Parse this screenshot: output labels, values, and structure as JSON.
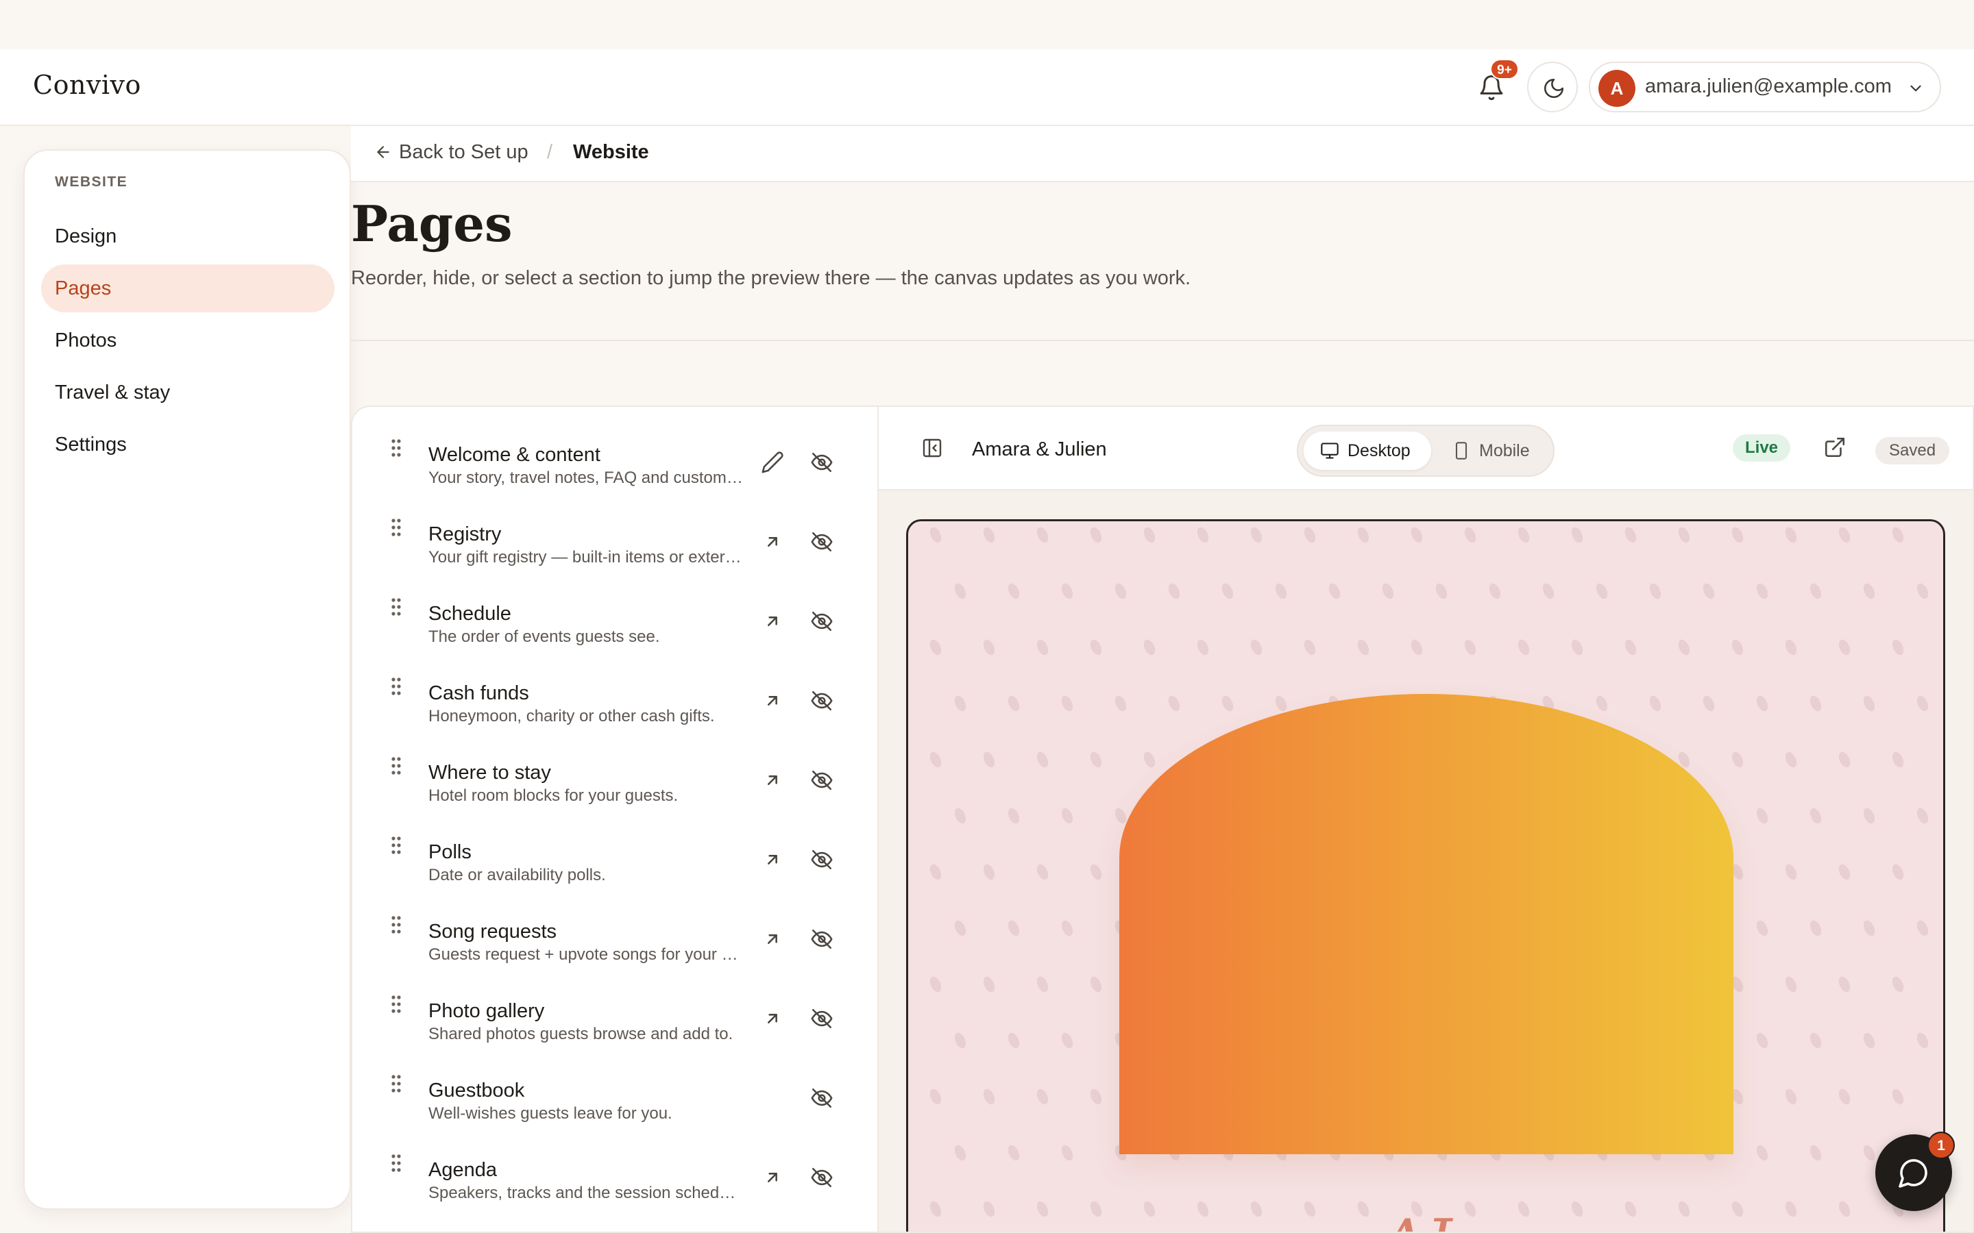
{
  "app": {
    "name": "Convivo"
  },
  "header": {
    "notifications_count": "9+",
    "user_initial": "A",
    "user_email": "amara.julien@example.com"
  },
  "sidebar": {
    "heading": "WEBSITE",
    "items": [
      {
        "label": "Design",
        "active": false
      },
      {
        "label": "Pages",
        "active": true
      },
      {
        "label": "Photos",
        "active": false
      },
      {
        "label": "Travel & stay",
        "active": false
      },
      {
        "label": "Settings",
        "active": false
      }
    ]
  },
  "breadcrumb": {
    "back_label": "Back to Set up",
    "separator": "/",
    "current": "Website"
  },
  "page": {
    "title": "Pages",
    "subtitle": "Reorder, hide, or select a section to jump the preview there — the canvas updates as you work."
  },
  "sections": [
    {
      "title": "Welcome & content",
      "description": "Your story, travel notes, FAQ and customize your site.",
      "action": "edit-icon"
    },
    {
      "title": "Registry",
      "description": "Your gift registry — built-in items or external links.",
      "action": "open-arrow-icon"
    },
    {
      "title": "Schedule",
      "description": "The order of events guests see.",
      "action": "open-arrow-icon"
    },
    {
      "title": "Cash funds",
      "description": "Honeymoon, charity or other cash gifts.",
      "action": "open-arrow-icon"
    },
    {
      "title": "Where to stay",
      "description": "Hotel room blocks for your guests.",
      "action": "open-arrow-icon"
    },
    {
      "title": "Polls",
      "description": "Date or availability polls.",
      "action": "open-arrow-icon"
    },
    {
      "title": "Song requests",
      "description": "Guests request + upvote songs for your playlist.",
      "action": "open-arrow-icon"
    },
    {
      "title": "Photo gallery",
      "description": "Shared photos guests browse and add to.",
      "action": "open-arrow-icon"
    },
    {
      "title": "Guestbook",
      "description": "Well-wishes guests leave for you.",
      "action": "none"
    },
    {
      "title": "Agenda",
      "description": "Speakers, tracks and the session schedule.",
      "action": "open-arrow-icon"
    }
  ],
  "preview": {
    "site_name": "Amara & Julien",
    "devices": [
      {
        "label": "Desktop",
        "active": true
      },
      {
        "label": "Mobile",
        "active": false
      }
    ],
    "status": "Live",
    "save_state": "Saved",
    "monogram": "AJ"
  },
  "chat": {
    "unread_count": "1"
  },
  "colors": {
    "accent": "#d54a1f",
    "active_bg": "#fbe7de",
    "canvas_bg": "#f5e1e2",
    "live": "#1f7a43"
  }
}
